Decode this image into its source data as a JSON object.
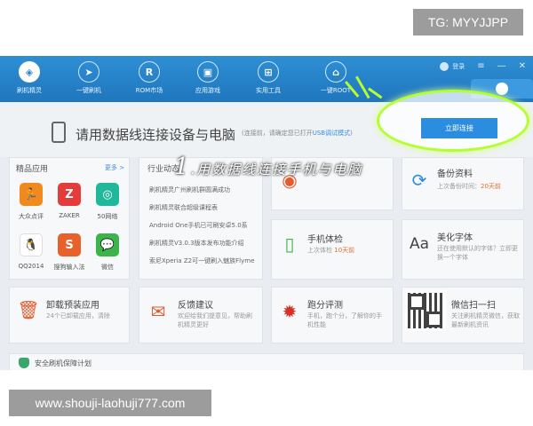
{
  "watermark_top": "TG: MYYJJPP",
  "watermark_bottom": "www.shouji-laohuji777.com",
  "nav": {
    "items": [
      {
        "label": "刷机精灵",
        "icon": "logo-icon"
      },
      {
        "label": "一键刷机",
        "icon": "cursor-icon"
      },
      {
        "label": "ROM市场",
        "icon": "rom-icon"
      },
      {
        "label": "应用游戏",
        "icon": "apps-icon"
      },
      {
        "label": "实用工具",
        "icon": "tools-icon"
      },
      {
        "label": "一键ROOT",
        "icon": "root-icon"
      }
    ],
    "login_label": "登录"
  },
  "connect": {
    "title": "请用数据线连接设备与电脑",
    "hint": "(连接前，请确定您已打开",
    "hint_link": "USB调试模式",
    "hint_end": ")",
    "button_label": "立即连接"
  },
  "featured_apps": {
    "title": "精品应用",
    "more": "更多 >",
    "apps": [
      {
        "label": "大众点评",
        "glyph": "🏃",
        "color": "#f08a1e"
      },
      {
        "label": "ZAKER",
        "glyph": "Z",
        "color": "#e43b3b"
      },
      {
        "label": "50网络",
        "glyph": "◎",
        "color": "#1fb89b"
      },
      {
        "label": "QQ2014",
        "glyph": "🐧",
        "color": "#333333"
      },
      {
        "label": "搜狗输入法",
        "glyph": "S",
        "color": "#e8612b"
      },
      {
        "label": "微信",
        "glyph": "💬",
        "color": "#3bb54a"
      }
    ]
  },
  "news": {
    "title": "行业动态",
    "items": [
      "刷机精灵广州刷机群圆满成功",
      "刷机精灵联合超级课程表",
      "Android One手机已可刷安卓5.0系",
      "刷机精灵V3.0.3版本发布功能介绍",
      "索尼Xperia Z2可一键刷入魅族Flyme"
    ]
  },
  "tools": [
    {
      "title": "备份资料",
      "desc_pre": "上次备份时间：",
      "desc_hl": "20天前",
      "icon": "backup-icon",
      "glyph": "⟳"
    },
    {
      "title": "手机体检",
      "desc_pre": "上次体检",
      "desc_hl": "10天前",
      "icon": "phone-check-icon",
      "glyph": "📱"
    },
    {
      "title": "美化字体",
      "desc_pre": "还在使用默认的字体？立即更换一个字体",
      "desc_hl": "",
      "icon": "font-icon",
      "glyph": "Aa"
    },
    {
      "title": "卸载预装应用",
      "desc_pre": "24个已卸载应用，清除",
      "desc_hl": "",
      "icon": "trash-icon",
      "glyph": "🗑"
    },
    {
      "title": "反馈建议",
      "desc_pre": "欢迎给我们提意见，帮助刷机精灵更好",
      "desc_hl": "",
      "icon": "mail-icon",
      "glyph": "✉"
    },
    {
      "title": "跑分评测",
      "desc_pre": "手机，跑个分，了解你的手机性能",
      "desc_hl": "",
      "icon": "benchmark-icon",
      "glyph": "⚙"
    },
    {
      "title": "微信扫一扫",
      "desc_pre": "关注刷机精灵微信，获取最新刷机资讯",
      "desc_hl": "",
      "icon": "qr-icon",
      "glyph": ""
    }
  ],
  "bottom": {
    "label": "安全刷机保障计划"
  },
  "annotation": {
    "number": "1",
    "text": ".用数据线连接手机与电脑"
  },
  "colors": {
    "topbar": "#2a86cc",
    "accent_button": "#2a8de0",
    "highlight_ring": "#b4ff30"
  }
}
